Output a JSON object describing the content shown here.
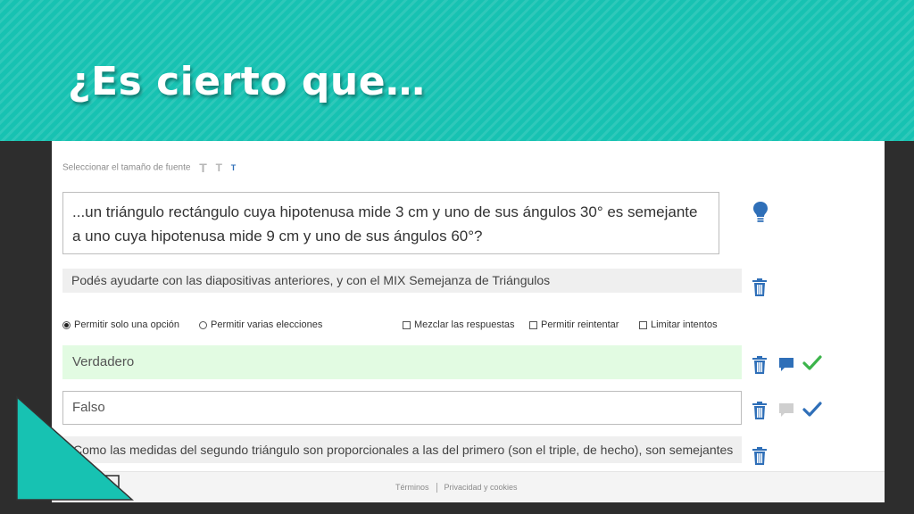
{
  "slide": {
    "title": "¿Es cierto que…"
  },
  "editor": {
    "font_size_label": "Seleccionar el tamaño de fuente",
    "font_sizes": [
      "T",
      "T",
      "T"
    ],
    "question": "...un triángulo rectángulo cuya hipotenusa mide 3 cm y uno de sus ángulos 30° es semejante a uno cuya hipotenusa mide 9 cm y uno de sus ángulos 60°?",
    "hint": "Podés ayudarte con las diapositivas anteriores, y con el MIX Semejanza de Triángulos",
    "options": {
      "single": "Permitir solo una opción",
      "multiple": "Permitir varias elecciones",
      "shuffle": "Mezclar las respuestas",
      "retry": "Permitir reintentar",
      "limit": "Limitar intentos",
      "selected": "single"
    },
    "answers": [
      {
        "label": "Verdadero",
        "correct": true
      },
      {
        "label": "Falso",
        "correct": false
      }
    ],
    "feedback": "Como las medidas del segundo triángulo son proporcionales a las del primero (son el triple, de hecho), son semejantes"
  },
  "footer": {
    "terms": "Términos",
    "privacy": "Privacidad y cookies"
  },
  "colors": {
    "banner": "#17c2b2",
    "accent_blue": "#2f6fb8",
    "correct_green": "#3cb44b",
    "correct_bg": "#e2fbe2"
  }
}
